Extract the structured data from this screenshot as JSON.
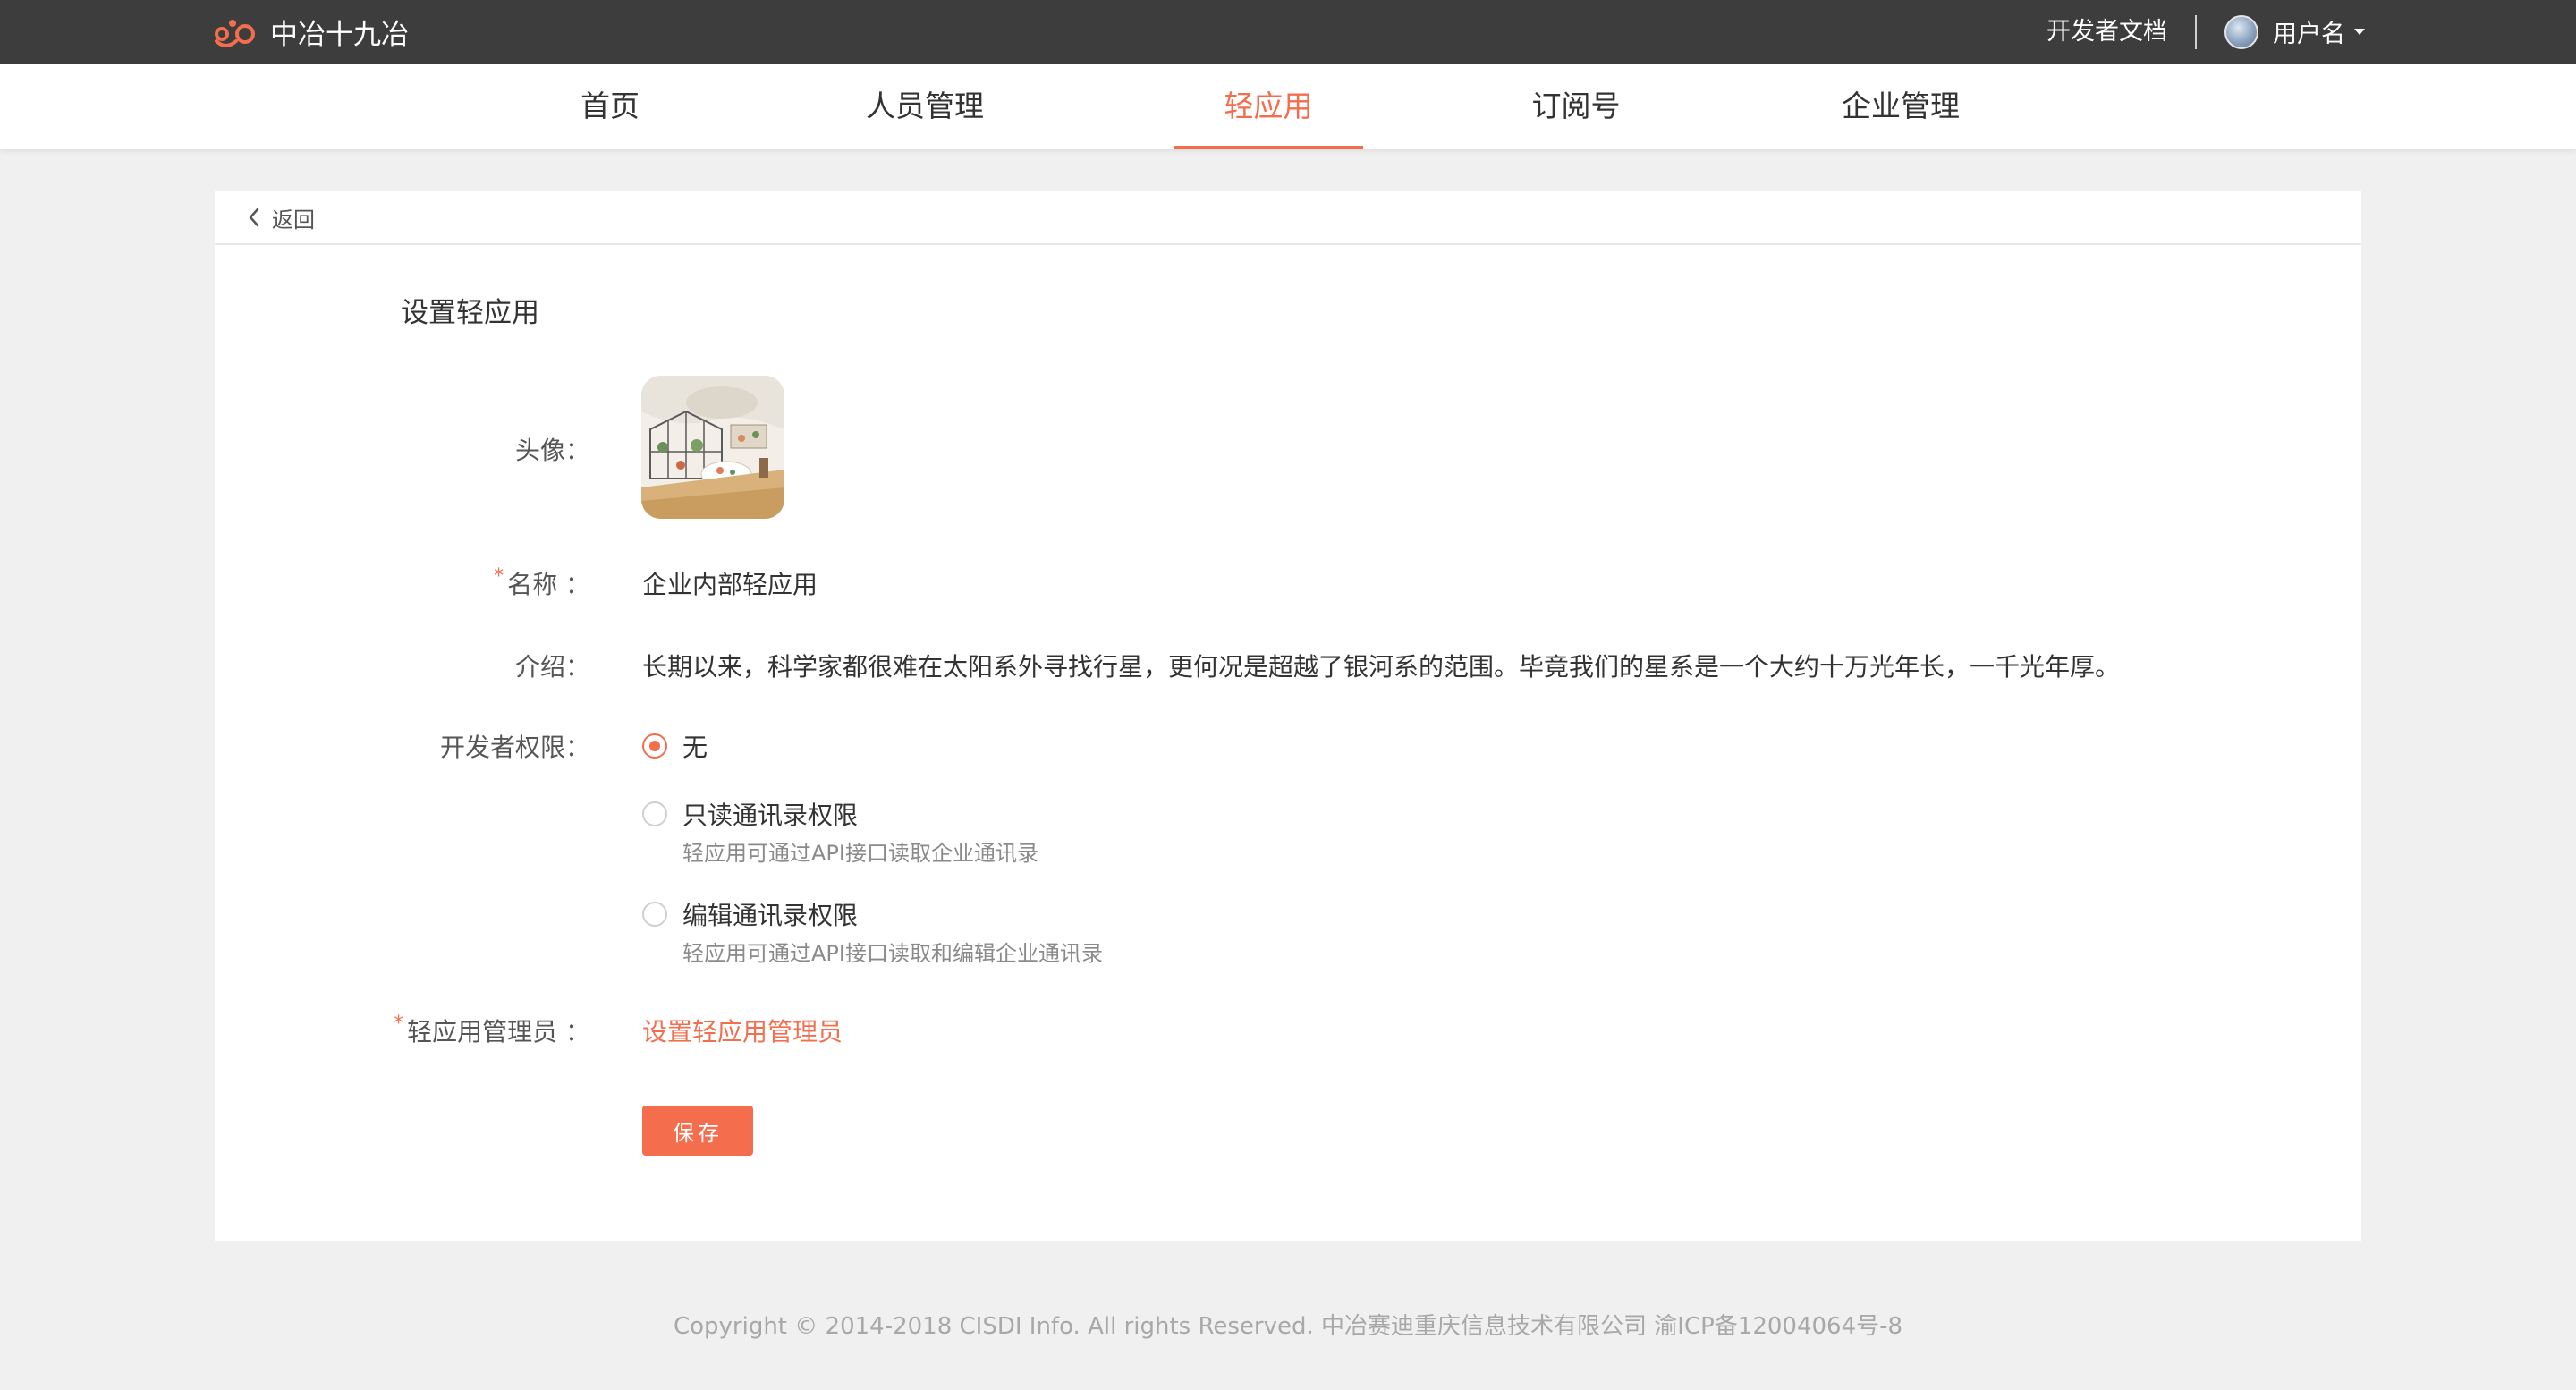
{
  "header": {
    "brand_name": "中冶十九冶",
    "dev_docs": "开发者文档",
    "username": "用户名"
  },
  "nav": {
    "items": [
      {
        "label": "首页"
      },
      {
        "label": "人员管理"
      },
      {
        "label": "轻应用"
      },
      {
        "label": "订阅号"
      },
      {
        "label": "企业管理"
      }
    ],
    "active": "轻应用"
  },
  "page": {
    "back_label": "返回",
    "title": "设置轻应用",
    "avatar_label": "头像：",
    "name_label": "名称 ：",
    "name_value": "企业内部轻应用",
    "intro_label": "介绍：",
    "intro_value": "长期以来，科学家都很难在太阳系外寻找行星，更何况是超越了银河系的范围。毕竟我们的星系是一个大约十万光年长，一千光年厚。",
    "permission_label": "开发者权限：",
    "permissions": [
      {
        "label": "无",
        "hint": "",
        "checked": true
      },
      {
        "label": "只读通讯录权限",
        "hint": "轻应用可通过API接口读取企业通讯录",
        "checked": false
      },
      {
        "label": "编辑通讯录权限",
        "hint": "轻应用可通过API接口读取和编辑企业通讯录",
        "checked": false
      }
    ],
    "admin_label": "轻应用管理员 ：",
    "admin_link": "设置轻应用管理员",
    "required_mark": "*",
    "save_label": "保存"
  },
  "footer": {
    "copyright": "Copyright © 2014-2018 CISDI Info. All rights Reserved. 中冶赛迪重庆信息技术有限公司 渝ICP备12004064号-8"
  },
  "colors": {
    "accent": "#f46e4e",
    "topbar": "#3d3d3d",
    "background": "#f0f0f0"
  }
}
